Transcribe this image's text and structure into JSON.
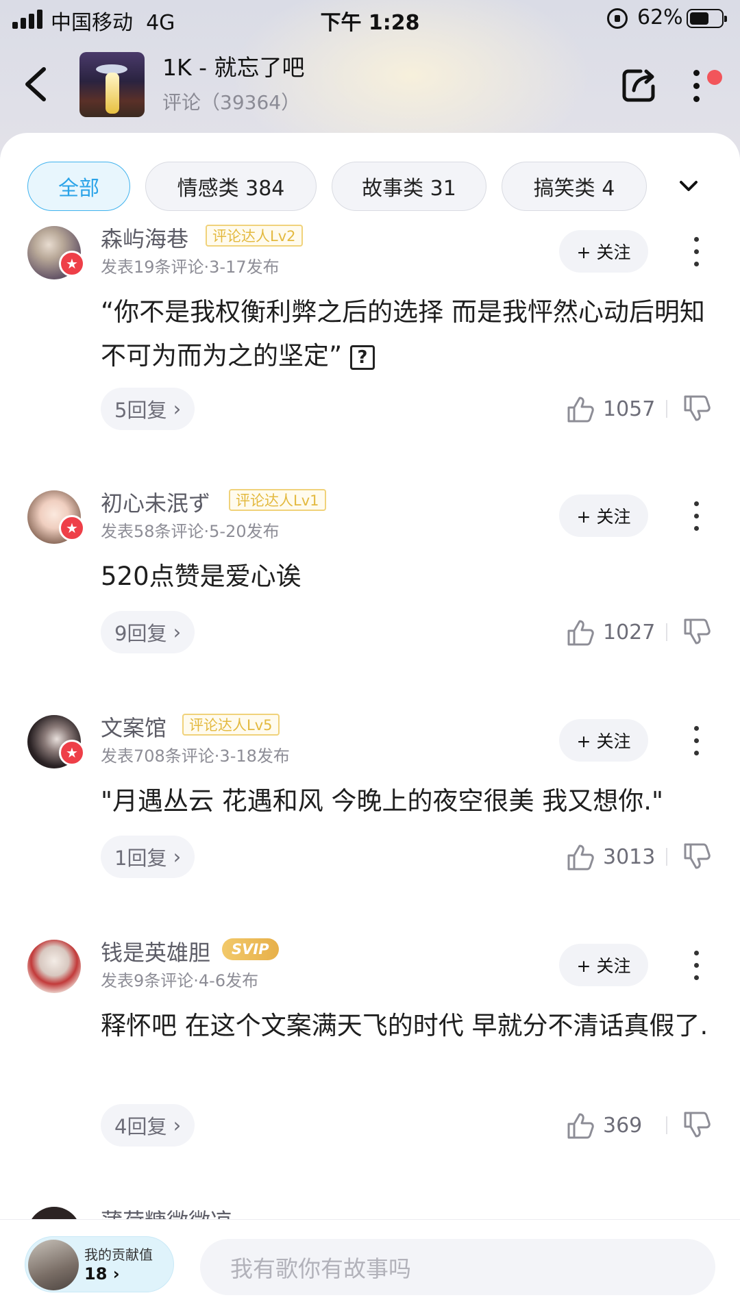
{
  "status_bar": {
    "carrier": "中国移动",
    "network": "4G",
    "time": "下午 1:28",
    "battery": "62%",
    "battery_level": 0.62
  },
  "header": {
    "title": "1K - 就忘了吧",
    "subtitle": "评论（39364）",
    "icons": [
      "back-arrow-icon",
      "share-icon",
      "more-icon"
    ]
  },
  "filters": [
    {
      "label": "全部",
      "active": true
    },
    {
      "label": "情感类 384",
      "active": false
    },
    {
      "label": "故事类 31",
      "active": false
    },
    {
      "label": "搞笑类 4",
      "active": false
    }
  ],
  "comments": [
    {
      "user": "森屿海巷",
      "badge": "评论达人Lv2",
      "meta": "发表19条评论·3-17发布",
      "text": "“你不是我权衡利弊之后的选择 而是我怦然心动后明知不可为而为之的坚定”",
      "follow": "+ 关注",
      "replies": "5回复",
      "likes": "1057"
    },
    {
      "user": "初心未泯ず",
      "badge": "评论达人Lv1",
      "meta": "发表58条评论·5-20发布",
      "text": "520点赞是爱心诶",
      "follow": "+ 关注",
      "replies": "9回复",
      "likes": "1027"
    },
    {
      "user": "文案馆",
      "badge": "评论达人Lv5",
      "meta": "发表708条评论·3-18发布",
      "text": "\"月遇丛云 花遇和风 今晚上的夜空很美 我又想你.\"",
      "follow": "+ 关注",
      "replies": "1回复",
      "likes": "3013"
    },
    {
      "user": "钱是英雄胆",
      "badge": "SVIP",
      "meta": "发表9条评论·4-6发布",
      "text": "释怀吧 在这个文案满天飞的时代 早就分不清话真假了.",
      "follow": "+ 关注",
      "replies": "4回复",
      "likes": "369"
    }
  ],
  "partial_user": "蒲荷糖微微凉",
  "bottom": {
    "contrib_label": "我的贡献值",
    "contrib_value": "18 ›",
    "input_placeholder": "我有歌你有故事吗"
  }
}
